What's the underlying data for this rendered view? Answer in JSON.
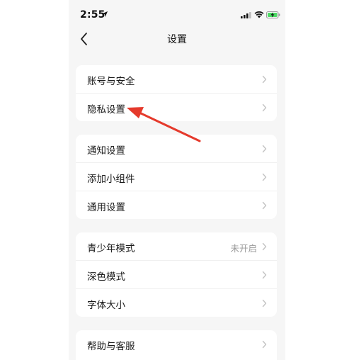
{
  "status_bar": {
    "time": "2:55",
    "icons": [
      "location-arrow-icon",
      "cellular-signal-icon",
      "wifi-icon",
      "battery-charging-icon"
    ]
  },
  "nav": {
    "title": "设置",
    "back_icon": "chevron-left-icon"
  },
  "groups": [
    {
      "items": [
        {
          "label": "账号与安全"
        },
        {
          "label": "隐私设置"
        }
      ]
    },
    {
      "items": [
        {
          "label": "通知设置"
        },
        {
          "label": "添加小组件"
        },
        {
          "label": "通用设置"
        }
      ]
    },
    {
      "items": [
        {
          "label": "青少年模式",
          "value": "未开启"
        },
        {
          "label": "深色模式"
        },
        {
          "label": "字体大小"
        }
      ]
    },
    {
      "items": [
        {
          "label": "帮助与客服"
        }
      ]
    }
  ],
  "colors": {
    "background": "#f6f6f6",
    "card": "#ffffff",
    "annotation_arrow": "#e53a2c",
    "battery_fill": "#4cd964"
  }
}
